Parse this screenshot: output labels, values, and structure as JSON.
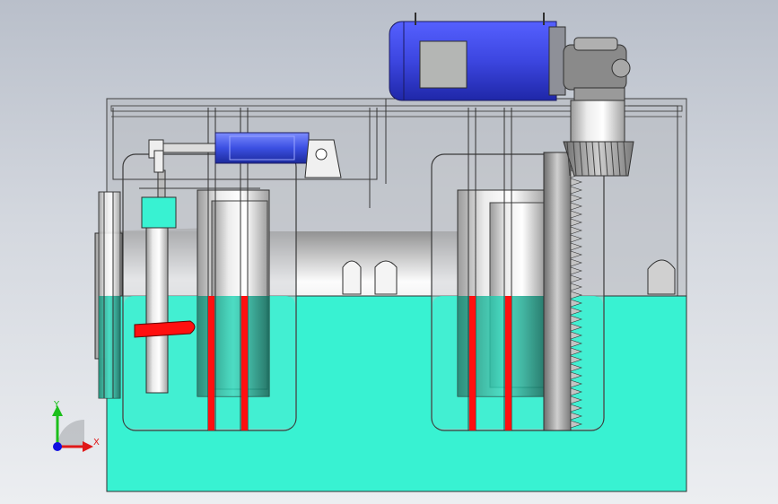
{
  "axes": {
    "x_label": "X",
    "y_label": "Y",
    "x_color": "#e01818",
    "y_color": "#1bbf1b",
    "z_color": "#1010e0"
  },
  "colors": {
    "fluid": "#38f2d2",
    "fluid_dark": "#1f9e86",
    "motor": "#3c46e0",
    "cylinder": "#3b4fe2",
    "pipe_red": "#ff1010",
    "steel": "#d8d8d8",
    "outline": "#303030"
  },
  "icons": {
    "triad": "coordinate-triad-icon"
  }
}
